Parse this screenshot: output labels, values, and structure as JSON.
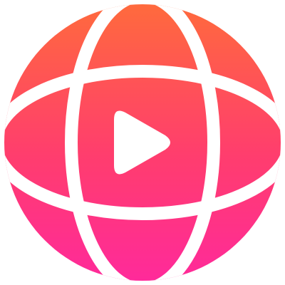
{
  "icon": {
    "name": "globe-play-icon",
    "gradient": {
      "top": "#ff6a3d",
      "middle": "#ff3d6e",
      "bottom": "#ff2a9a"
    },
    "line_color": "#ffffff",
    "play_color": "#ffffff"
  }
}
